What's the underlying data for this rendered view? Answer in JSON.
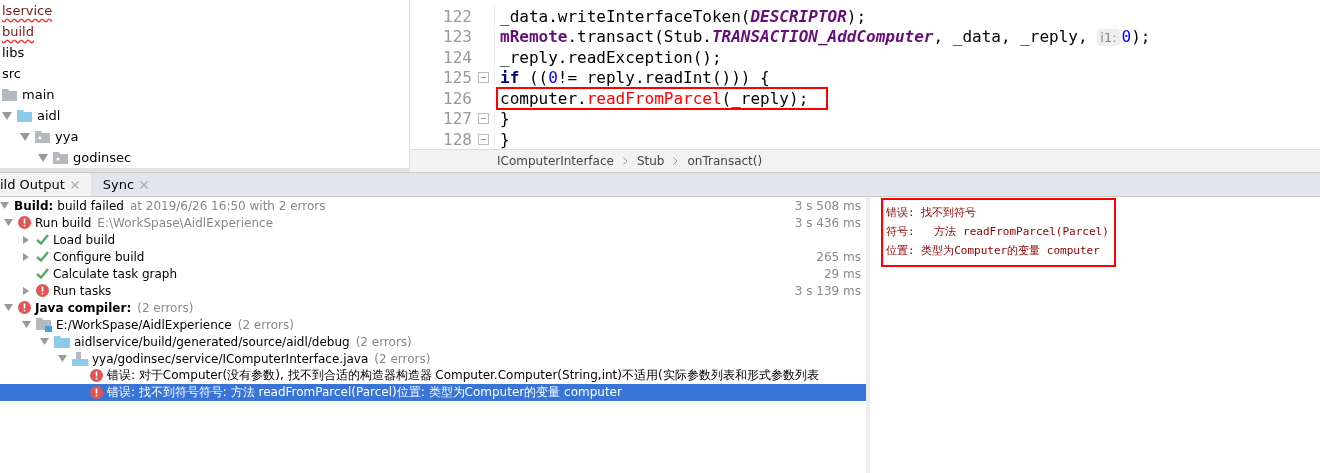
{
  "project_tree": [
    {
      "label": "lservice",
      "kind": "plain",
      "error": true
    },
    {
      "label": "build",
      "kind": "plain",
      "error": true
    },
    {
      "label": "libs",
      "kind": "plain",
      "error": false
    },
    {
      "label": "src",
      "kind": "plain",
      "error": false
    },
    {
      "label": "main",
      "kind": "folder",
      "error": false,
      "children": [
        {
          "label": "aidl",
          "kind": "source-folder",
          "error": false,
          "expanded": true,
          "children": [
            {
              "label": "yya",
              "kind": "package",
              "error": false,
              "expanded": true,
              "children": [
                {
                  "label": "godinsec",
                  "kind": "package",
                  "error": false,
                  "expanded": true
                }
              ]
            }
          ]
        }
      ]
    }
  ],
  "editor": {
    "lines": [
      {
        "number": "122",
        "fold": false,
        "boxed": false,
        "tokens": [
          {
            "t": "_data.writeInterfaceToken(",
            "kind": "plain"
          },
          {
            "t": "DESCRIPTOR",
            "kind": "const"
          },
          {
            "t": ");",
            "kind": "plain"
          }
        ]
      },
      {
        "number": "123",
        "fold": false,
        "boxed": false,
        "tokens": [
          {
            "t": "mRemote",
            "kind": "field"
          },
          {
            "t": ".transact(Stub.",
            "kind": "plain"
          },
          {
            "t": "TRANSACTION_AddComputer",
            "kind": "const"
          },
          {
            "t": ", _data, _reply, ",
            "kind": "plain"
          },
          {
            "t": "i1:",
            "kind": "hint"
          },
          {
            "t": "0",
            "kind": "number"
          },
          {
            "t": ");",
            "kind": "plain"
          }
        ]
      },
      {
        "number": "124",
        "fold": false,
        "boxed": false,
        "tokens": [
          {
            "t": "_reply.readException();",
            "kind": "plain"
          }
        ]
      },
      {
        "number": "125",
        "fold": true,
        "boxed": false,
        "tokens": [
          {
            "t": "if",
            "kind": "keyword"
          },
          {
            "t": " ((",
            "kind": "plain"
          },
          {
            "t": "0",
            "kind": "number"
          },
          {
            "t": "!= reply.readInt())) {",
            "kind": "plain"
          }
        ]
      },
      {
        "number": "126",
        "fold": false,
        "boxed": true,
        "tokens": [
          {
            "t": "computer.",
            "kind": "plain"
          },
          {
            "t": "readFromParcel",
            "kind": "error"
          },
          {
            "t": "(_reply);",
            "kind": "plain"
          }
        ]
      },
      {
        "number": "127",
        "fold": true,
        "boxed": false,
        "tokens": [
          {
            "t": "}",
            "kind": "plain"
          }
        ]
      },
      {
        "number": "128",
        "fold": true,
        "boxed": false,
        "tokens": [
          {
            "t": "}",
            "kind": "plain"
          }
        ]
      }
    ],
    "breadcrumbs": [
      "IComputerInterface",
      "Stub",
      "onTransact()"
    ]
  },
  "tool_tabs": [
    {
      "label": "ild Output",
      "selected": true
    },
    {
      "label": "Sync",
      "selected": false
    }
  ],
  "build_tree": [
    {
      "title": "Build:",
      "text": "build failed",
      "detail": "at 2019/6/26 16:50  with 2 errors",
      "time": "3 s 508 ms",
      "selected": false,
      "expanded": true,
      "children": [
        {
          "text": "Run build",
          "detail": "E:\\WorkSpase\\AidlExperience",
          "kind": "error",
          "time": "3 s 436 ms",
          "selected": false,
          "expanded": true,
          "children": [
            {
              "text": "Load build",
              "kind": "ok",
              "selected": false,
              "expanded": false
            },
            {
              "text": "Configure build",
              "kind": "ok",
              "time": "265 ms",
              "selected": false,
              "expanded": false
            },
            {
              "text": "Calculate task graph",
              "kind": "ok",
              "time": "29 ms",
              "selected": false
            },
            {
              "text": "Run tasks",
              "kind": "error",
              "time": "3 s 139 ms",
              "selected": false,
              "expanded": false
            }
          ]
        },
        {
          "title": "Java compiler:",
          "detail": "(2 errors)",
          "kind": "error",
          "selected": false,
          "expanded": true,
          "children": [
            {
              "text": "E:/WorkSpase/AidlExperience",
              "detail": "(2 errors)",
              "kind": "module",
              "selected": false,
              "expanded": true,
              "children": [
                {
                  "text": "aidlservice/build/generated/source/aidl/debug",
                  "detail": "(2 errors)",
                  "kind": "folder",
                  "selected": false,
                  "expanded": true,
                  "children": [
                    {
                      "text": "yya/godinsec/service/IComputerInterface.java",
                      "detail": "(2 errors)",
                      "kind": "file",
                      "selected": false,
                      "expanded": true,
                      "children": [
                        {
                          "text": "错误: 对于Computer(没有参数), 找不到合适的构造器构造器 Computer.Computer(String,int)不适用(实际参数列表和形式参数列表",
                          "kind": "error",
                          "selected": false
                        },
                        {
                          "text": "错误: 找不到符号符号:   方法 readFromParcel(Parcel)位置: 类型为Computer的变量 computer",
                          "kind": "error",
                          "selected": true
                        }
                      ]
                    }
                  ]
                }
              ]
            }
          ]
        }
      ]
    }
  ],
  "detail_panel": {
    "lines": [
      "错误: 找不到符号",
      "符号:   方法 readFromParcel(Parcel)",
      "位置: 类型为Computer的变量 computer"
    ]
  }
}
